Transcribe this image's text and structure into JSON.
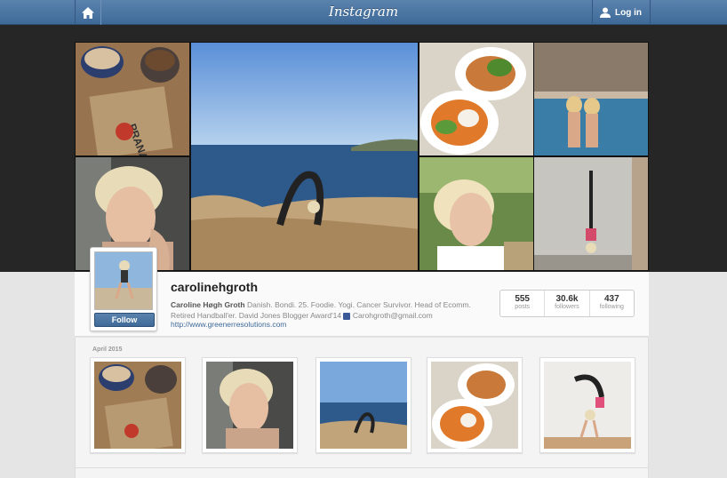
{
  "topbar": {
    "brand": "Instagram",
    "login_label": "Log in",
    "home_icon": "home-icon",
    "user_icon": "user-icon"
  },
  "profile": {
    "username": "carolinehgroth",
    "full_name": "Caroline Høgh Groth",
    "bio": " Danish. Bondi. 25. Foodie. Yogi. Cancer Survivor. Head of Ecomm. Retired Handball'er. David Jones Blogger Award'14 ",
    "email": " Carohgroth@gmail.com",
    "website": "http://www.greenerresolutions.com",
    "follow_label": "Follow",
    "stats": [
      {
        "value": "555",
        "label": "posts"
      },
      {
        "value": "30.6k",
        "label": "followers"
      },
      {
        "value": "437",
        "label": "following"
      }
    ]
  },
  "feed": {
    "month_label": "April 2015"
  },
  "colors": {
    "accent": "#3f6a98",
    "header_band": "#262626"
  }
}
